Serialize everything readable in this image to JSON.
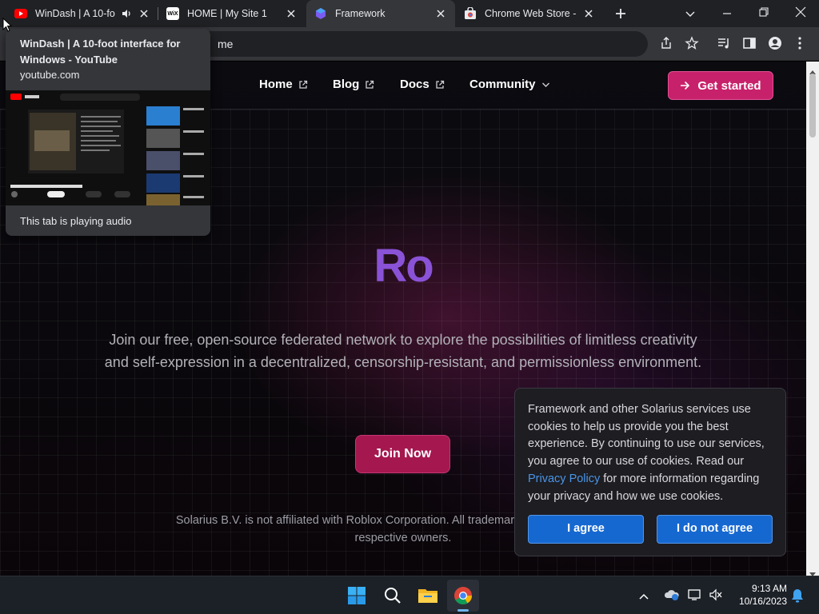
{
  "browser": {
    "tabs": [
      {
        "title": "WinDash | A 10-foot interface for Windows - YouTube",
        "favicon": "youtube-icon",
        "audio": true
      },
      {
        "title": "HOME | My Site 1",
        "favicon": "wix-icon"
      },
      {
        "title": "Framework",
        "favicon": "framework-icon",
        "active": true
      },
      {
        "title": "Chrome Web Store - Extensions",
        "favicon": "chrome-web-store-icon"
      }
    ],
    "wix_favicon_text": "WiX",
    "omnibox_text": "me"
  },
  "hovercard": {
    "title": "WinDash | A 10-foot interface for Windows - YouTube",
    "domain": "youtube.com",
    "audio_status": "This tab is playing audio"
  },
  "site": {
    "nav": [
      {
        "label": "Home",
        "icon": "external-link-icon"
      },
      {
        "label": "Blog",
        "icon": "external-link-icon"
      },
      {
        "label": "Docs",
        "icon": "external-link-icon"
      },
      {
        "label": "Community",
        "icon": "chevron-down-icon"
      }
    ],
    "cta_label": "Get started",
    "hero_title": "Ro",
    "hero_subtitle": "Join our free, open-source federated network to explore the possibilities of limitless creativity and self-expression in a decentralized, censorship-resistant, and permissionless environment.",
    "join_label": "Join Now",
    "disclaimer": "Solarius B.V. is not affiliated with Roblox Corporation. All trademarks are property of their respective owners."
  },
  "cookie": {
    "text_before": "Framework and other Solarius services use cookies to help us provide you the best experience. By continuing to use our services, you agree to our use of cookies. Read our ",
    "link": "Privacy Policy",
    "text_after": " for more information regarding your privacy and how we use cookies.",
    "agree": "I agree",
    "disagree": "I do not agree"
  },
  "taskbar": {
    "time": "9:13 AM",
    "date": "10/16/2023"
  },
  "colors": {
    "accent": "#c8216b",
    "hero_title": "#8a52d6",
    "cookie_button": "#1668d1",
    "link": "#4a95e6"
  }
}
